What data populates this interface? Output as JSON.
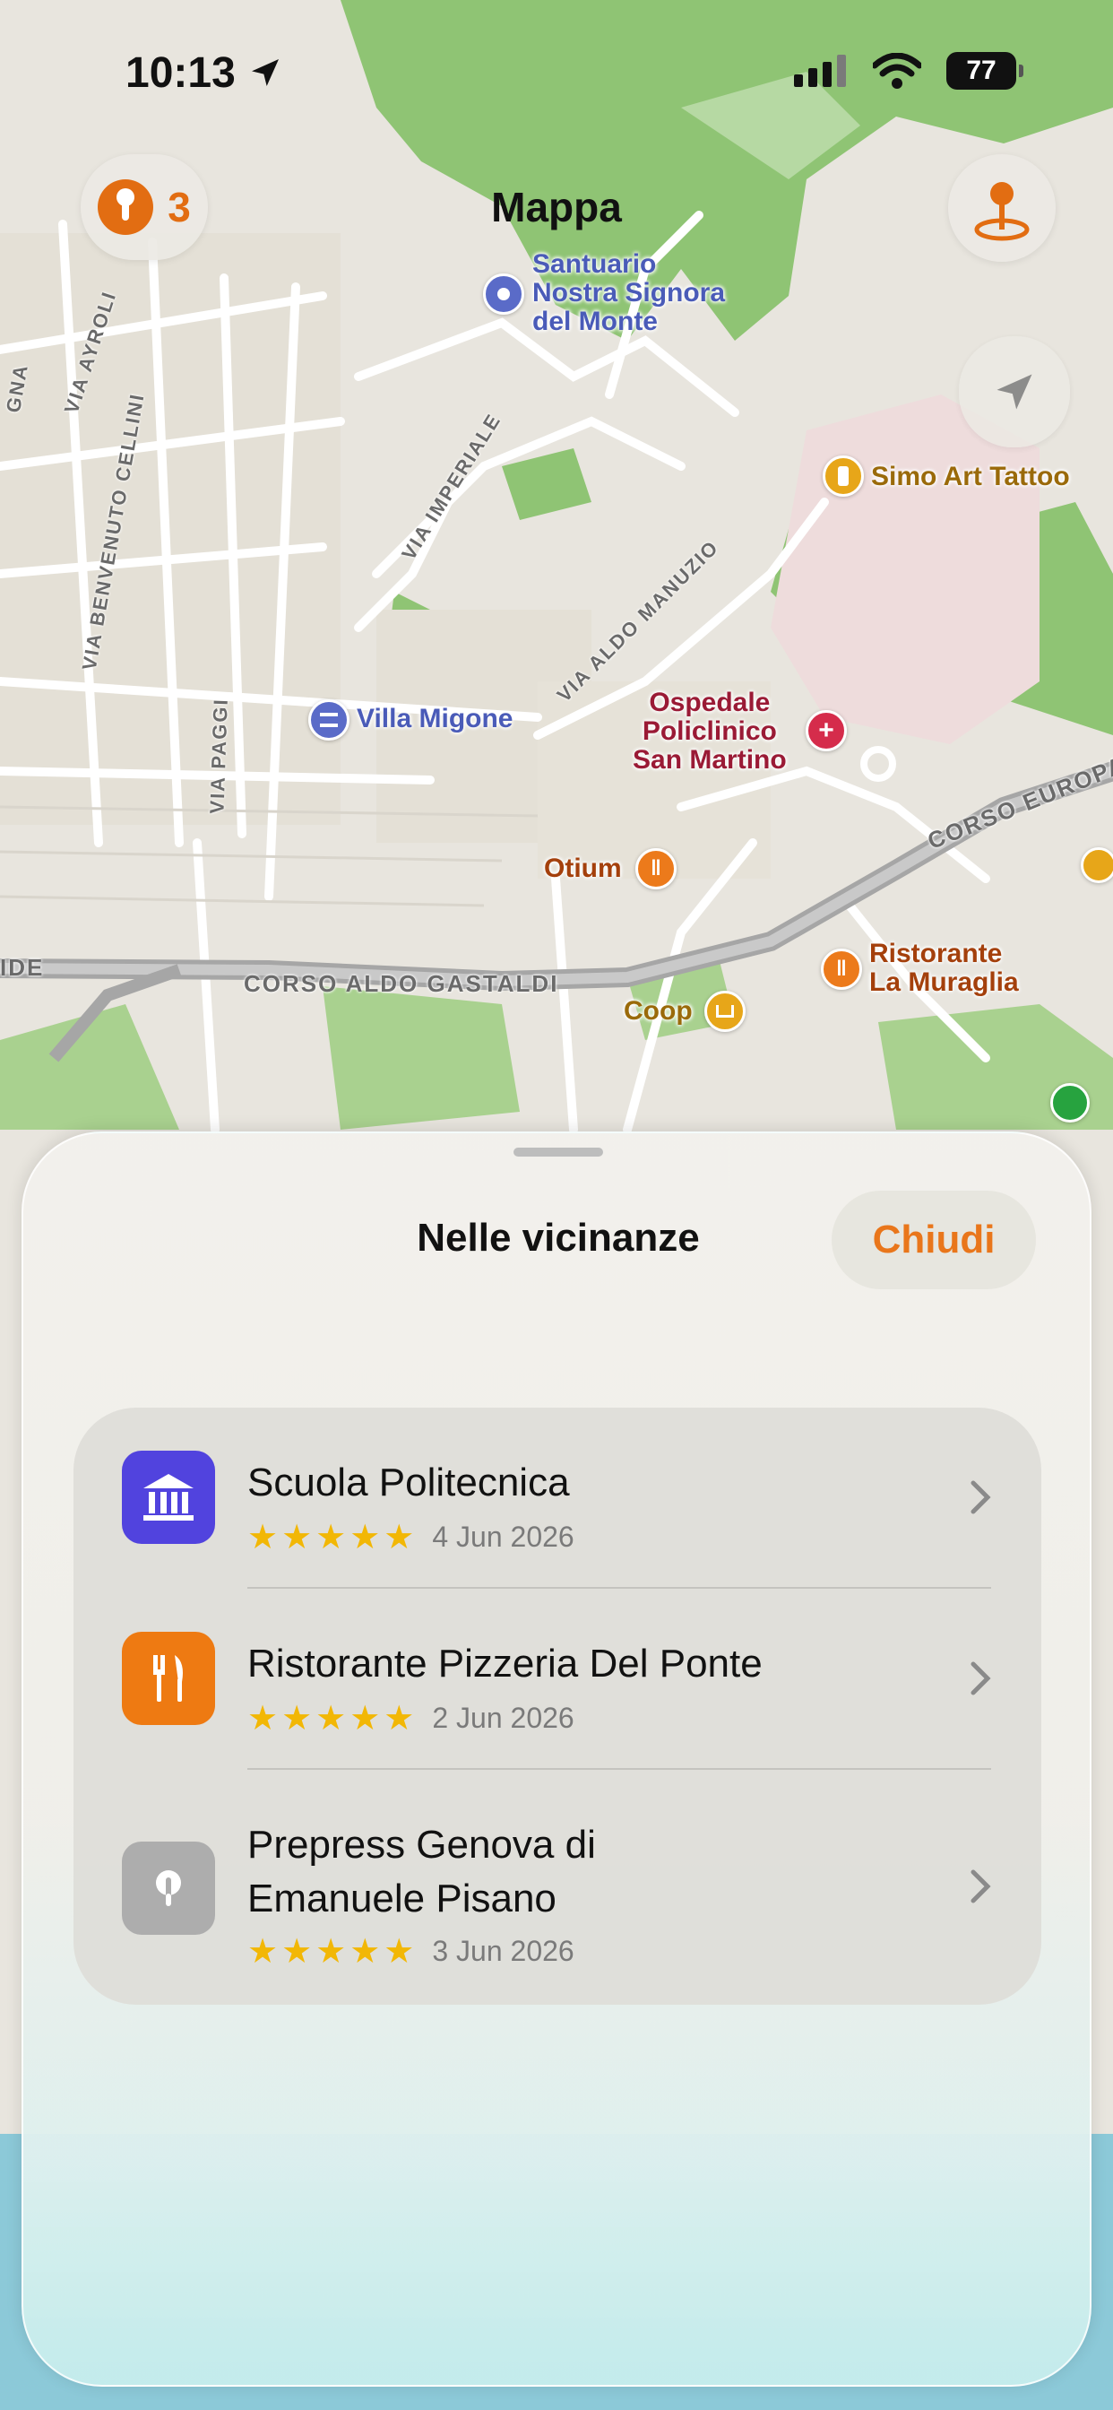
{
  "status_bar": {
    "time": "10:13",
    "battery": "77"
  },
  "header": {
    "title": "Mappa",
    "pins_count": "3"
  },
  "map_labels": {
    "santuario": [
      "Santuario",
      "Nostra Signora",
      "del Monte"
    ],
    "simo_art_tattoo": "Simo Art Tattoo",
    "villa_migone": "Villa Migone",
    "ospedale": [
      "Ospedale",
      "Policlinico",
      "San Martino"
    ],
    "otium": "Otium",
    "ristorante_muraglia": [
      "Ristorante",
      "La Muraglia"
    ],
    "coop": "Coop",
    "streets": {
      "via_ayroli": "VIA AYROLI",
      "via_benvenuto_cellini": "VIA BENVENUTO CELLINI",
      "via_imperiale": "VIA IMPERIALE",
      "via_aldo_manuzio": "VIA ALDO MANUZIO",
      "via_paggi": "VIA PAGGI",
      "corso_aldo_gastaldi": "CORSO ALDO GASTALDI",
      "corso_europa": "CORSO EUROPA",
      "gna": "GNA",
      "ide": "IDE"
    }
  },
  "sheet": {
    "title": "Nelle vicinanze",
    "close_label": "Chiudi",
    "items": [
      {
        "title": "Scuola Politecnica",
        "title_lines": [
          "Scuola Politecnica"
        ],
        "rating": 5,
        "stars": "★★★★★",
        "date": "4 Jun 2026",
        "icon": "museum-icon",
        "color": "#5143de"
      },
      {
        "title": "Ristorante Pizzeria Del Ponte",
        "title_lines": [
          "Ristorante Pizzeria Del Ponte"
        ],
        "rating": 5,
        "stars": "★★★★★",
        "date": "2 Jun 2026",
        "icon": "fork-knife-icon",
        "color": "#ee7a12"
      },
      {
        "title": "Prepress Genova di Emanuele Pisano",
        "title_lines": [
          "Prepress Genova di",
          "Emanuele Pisano"
        ],
        "rating": 5,
        "stars": "★★★★★",
        "date": "3 Jun 2026",
        "icon": "pin-icon",
        "color": "#adadad"
      }
    ]
  },
  "colors": {
    "accent": "#e9761b",
    "star": "#f2b705",
    "park": "#86c06a",
    "water": "#8cc9d8"
  }
}
